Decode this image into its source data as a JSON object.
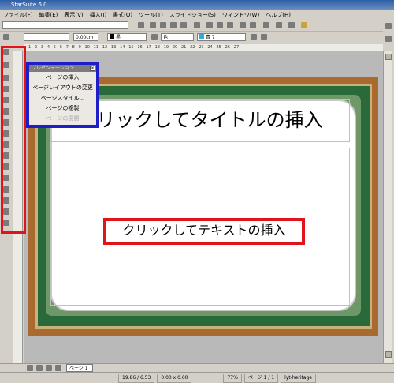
{
  "window": {
    "title": "StarSuite 6.0"
  },
  "menu": [
    "ファイル(F)",
    "編集(E)",
    "表示(V)",
    "挿入(I)",
    "書式(O)",
    "ツール(T)",
    "スライドショー(S)",
    "ウィンドウ(W)",
    "ヘルプ(H)"
  ],
  "toolbar2": {
    "line_width": "0.00cm",
    "line_color": "黒",
    "area_style": "色",
    "area_color": "青 7"
  },
  "slide": {
    "title_placeholder": "クリックしてタイトルの挿入",
    "text_placeholder": "クリックしてテキストの挿入"
  },
  "popup": {
    "title": "プレゼンテーション",
    "items": [
      "ページの挿入",
      "ページレイアウトの変更",
      "ページスタイル...",
      "ページの複製",
      "ページの展開"
    ]
  },
  "tabs": {
    "page1": "ページ 1"
  },
  "status": {
    "position": "19.86 / 6.53",
    "size": "0.00 x 0.00",
    "zoom": "77%",
    "page": "ページ 1 / 1",
    "layout": "lyt-heritage"
  },
  "ruler": {
    "top_labels": "1 · 2 · 3 · 4 · 5 · 6 · 7 · 8 · 9 · 10 · 11 · 12 · 13 · 14 · 15 · 16 · 17 · 18 · 19 · 20 · 21 · 22 · 23 · 24 · 25 · 26 · 27"
  }
}
